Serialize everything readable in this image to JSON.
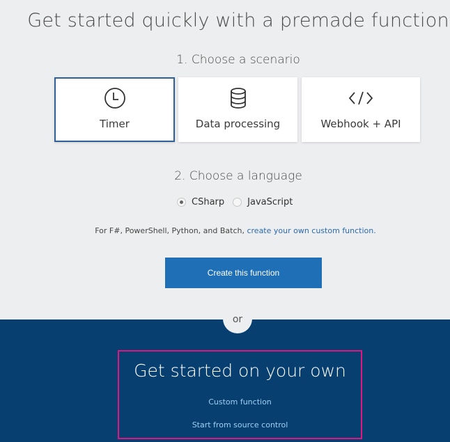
{
  "hero": {
    "title": "Get started quickly with a premade function"
  },
  "step1": {
    "label": "1. Choose a scenario",
    "scenarios": [
      {
        "label": "Timer",
        "icon": "clock-icon",
        "selected": true
      },
      {
        "label": "Data processing",
        "icon": "database-icon",
        "selected": false
      },
      {
        "label": "Webhook + API",
        "icon": "code-icon",
        "selected": false
      }
    ]
  },
  "step2": {
    "label": "2. Choose a language",
    "options": [
      {
        "label": "CSharp",
        "selected": true
      },
      {
        "label": "JavaScript",
        "selected": false
      }
    ]
  },
  "note": {
    "text": "For F#, PowerShell, Python, and Batch, ",
    "link": "create your own custom function."
  },
  "create_button": "Create this function",
  "divider": "or",
  "own": {
    "title": "Get started on your own",
    "links": [
      "Custom function",
      "Start from source control"
    ]
  },
  "colors": {
    "top_background": "#edeeef",
    "bottom_background": "#073f70",
    "primary_button": "#1e6fb6",
    "highlight_border": "#e0177f",
    "selected_tile_border": "#2f6198",
    "link": "#2a6ab0"
  }
}
